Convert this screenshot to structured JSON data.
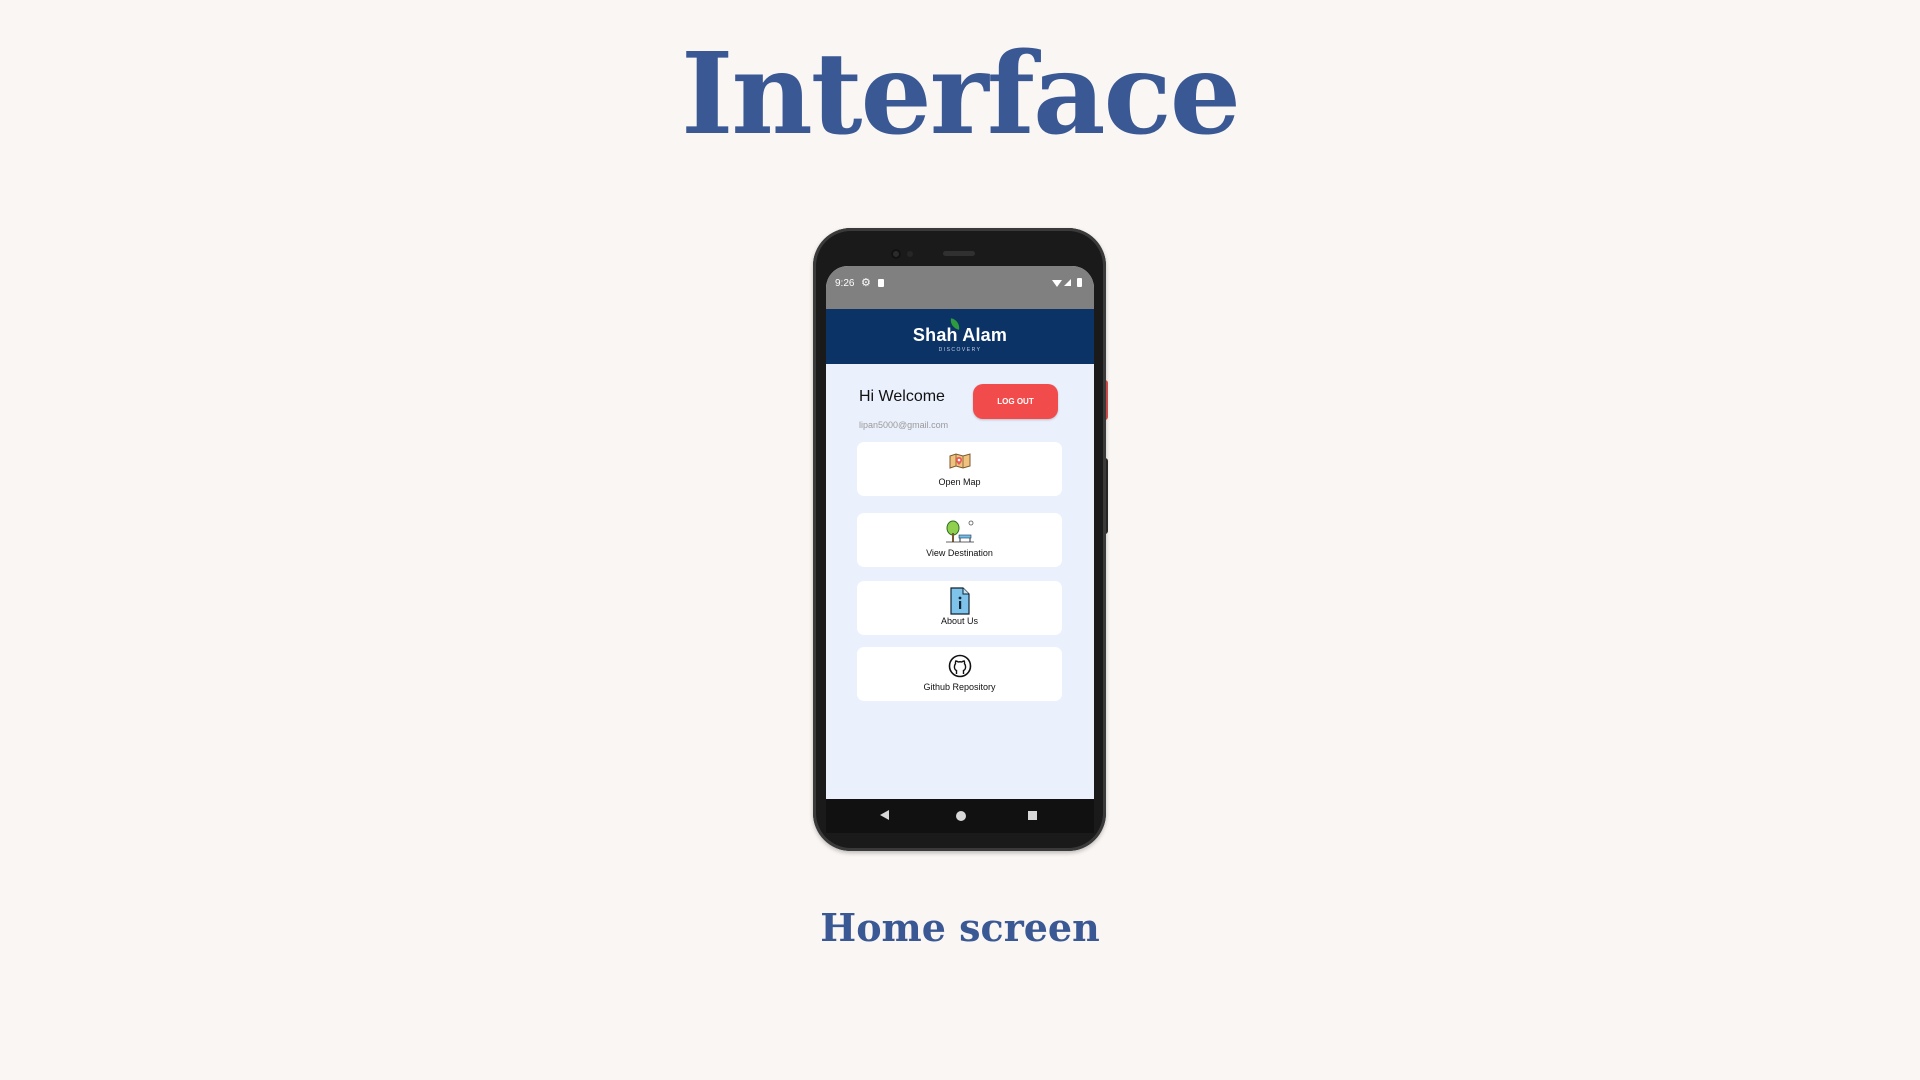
{
  "slide": {
    "title": "Interface",
    "caption": "Home screen"
  },
  "status_bar": {
    "time": "9:26",
    "icons": [
      "gear-icon",
      "sd-card-icon",
      "wifi-icon",
      "signal-icon",
      "battery-icon"
    ]
  },
  "app_header": {
    "logo_text": "Shah Alam",
    "logo_subtext": "DISCOVERY"
  },
  "user": {
    "greeting": "Hi Welcome",
    "email": "lipan5000@gmail.com",
    "logout_label": "LOG OUT"
  },
  "menu": [
    {
      "label": "Open Map",
      "icon": "map-icon"
    },
    {
      "label": "View Destination",
      "icon": "park-icon"
    },
    {
      "label": "About Us",
      "icon": "info-document-icon"
    },
    {
      "label": "Github Repository",
      "icon": "github-icon"
    }
  ],
  "nav_bar": {
    "icons": [
      "back-icon",
      "home-icon",
      "recents-icon"
    ]
  },
  "colors": {
    "background": "#faf6f3",
    "title": "#3a5894",
    "header": "#0c3366",
    "status_bar": "#808080",
    "screen_bg": "#eaf0fc",
    "logout": "#f24b4b"
  }
}
